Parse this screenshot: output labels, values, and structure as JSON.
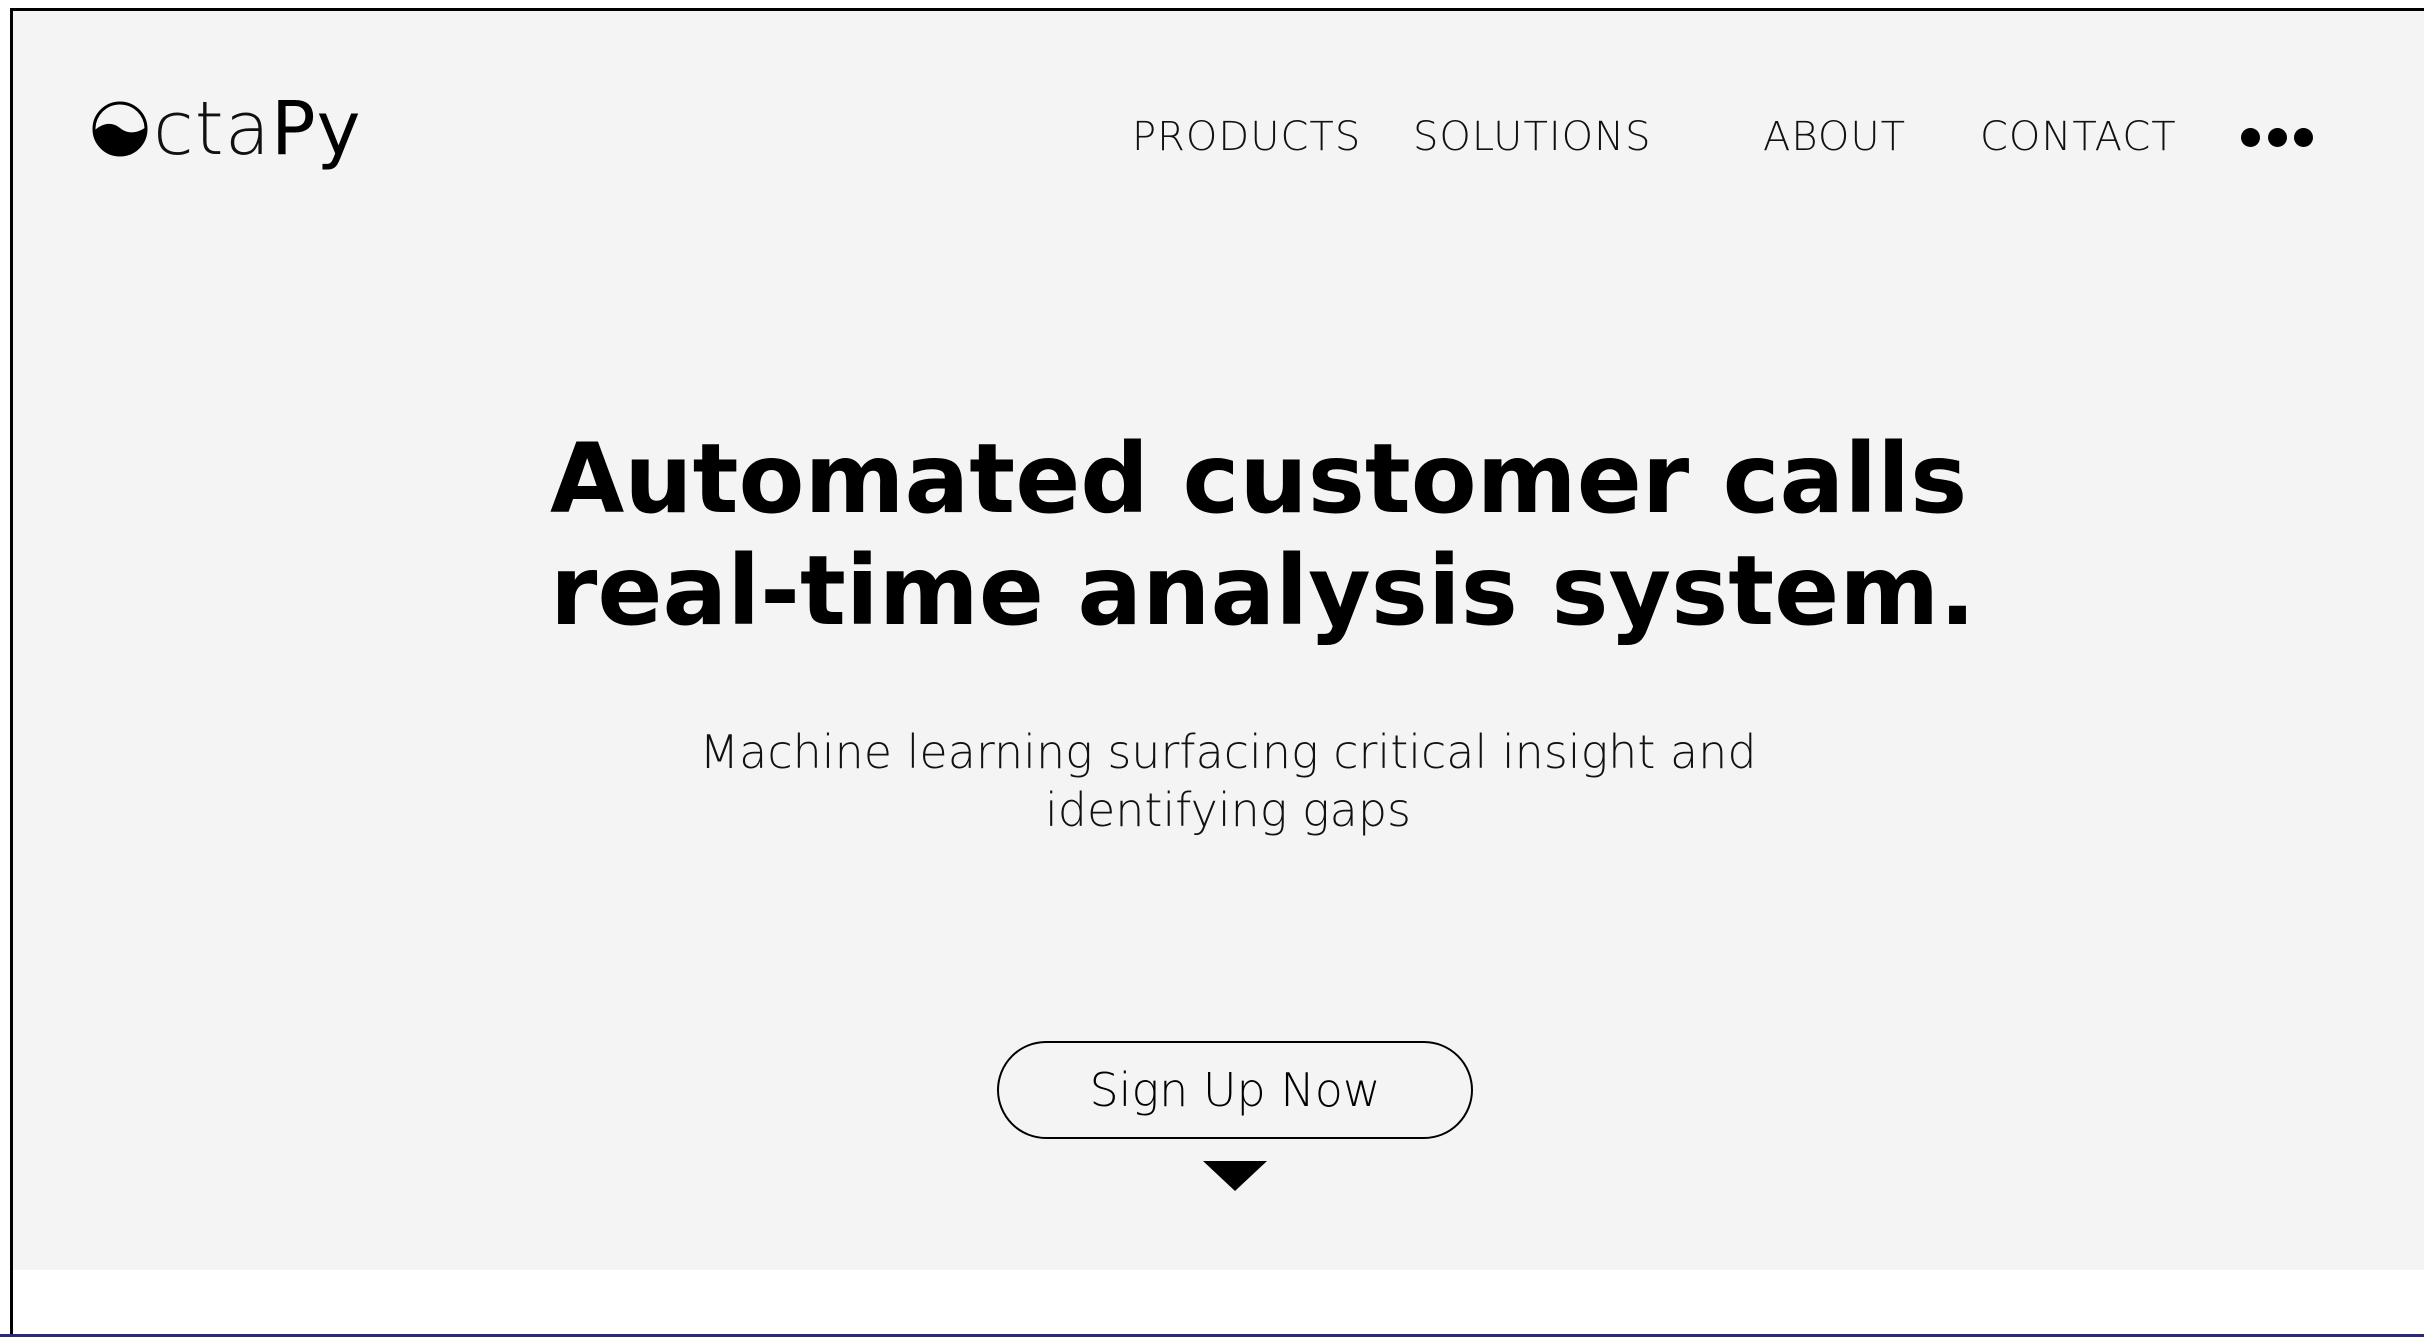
{
  "brand": {
    "logo_text_prefix": "cta",
    "logo_text_suffix": "Py",
    "logo_icon": "half-filled-circle-icon"
  },
  "nav": {
    "items": [
      {
        "label": "PRODUCTS"
      },
      {
        "label": "SOLUTIONS"
      },
      {
        "label": "ABOUT"
      },
      {
        "label": "CONTACT"
      }
    ],
    "more_icon": "more-dots-icon"
  },
  "hero": {
    "headline_line1": "Automated customer calls",
    "headline_line2": "real-time analysis system.",
    "subheadline_line1": "Machine learning surfacing critical insight and",
    "subheadline_line2": "identifying gaps",
    "cta_label": "Sign Up Now",
    "scroll_icon": "triangle-down-icon"
  },
  "colors": {
    "hero_background": "#f4f4f4",
    "page_background": "#ffffff",
    "text": "#000000",
    "bottom_border": "#2b2a7a"
  }
}
